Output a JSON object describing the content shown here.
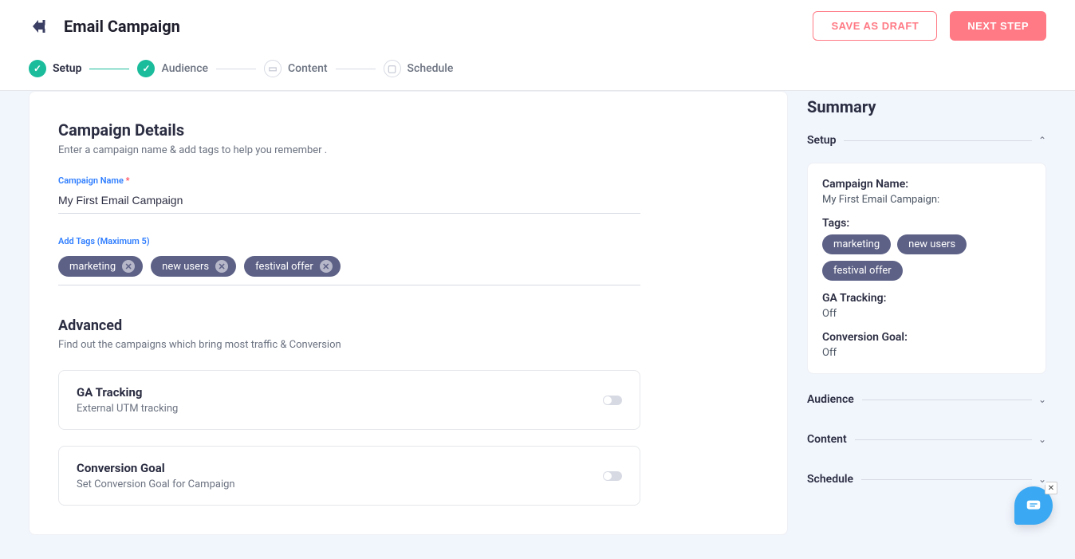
{
  "header": {
    "title": "Email Campaign",
    "save_draft": "SAVE AS DRAFT",
    "next_step": "NEXT STEP"
  },
  "steps": {
    "setup": "Setup",
    "audience": "Audience",
    "content": "Content",
    "schedule": "Schedule"
  },
  "details": {
    "title": "Campaign Details",
    "subtitle": "Enter a campaign name & add tags to help you remember .",
    "name_label": "Campaign Name",
    "name_value": "My First Email Campaign",
    "tags_label": "Add Tags (Maximum 5)",
    "tags": [
      "marketing",
      "new users",
      "festival offer"
    ]
  },
  "advanced": {
    "title": "Advanced",
    "subtitle": "Find out the campaigns which bring most traffic & Conversion",
    "ga_title": "GA Tracking",
    "ga_sub": "External UTM tracking",
    "cg_title": "Conversion Goal",
    "cg_sub": "Set Conversion Goal for Campaign"
  },
  "summary": {
    "title": "Summary",
    "sections": {
      "setup": "Setup",
      "audience": "Audience",
      "content": "Content",
      "schedule": "Schedule"
    },
    "campaign_name_label": "Campaign Name:",
    "campaign_name_value": "My First Email Campaign:",
    "tags_label": "Tags:",
    "tags": [
      "marketing",
      "new users",
      "festival offer"
    ],
    "ga_label": "GA Tracking:",
    "ga_value": "Off",
    "cg_label": "Conversion Goal:",
    "cg_value": "Off"
  }
}
